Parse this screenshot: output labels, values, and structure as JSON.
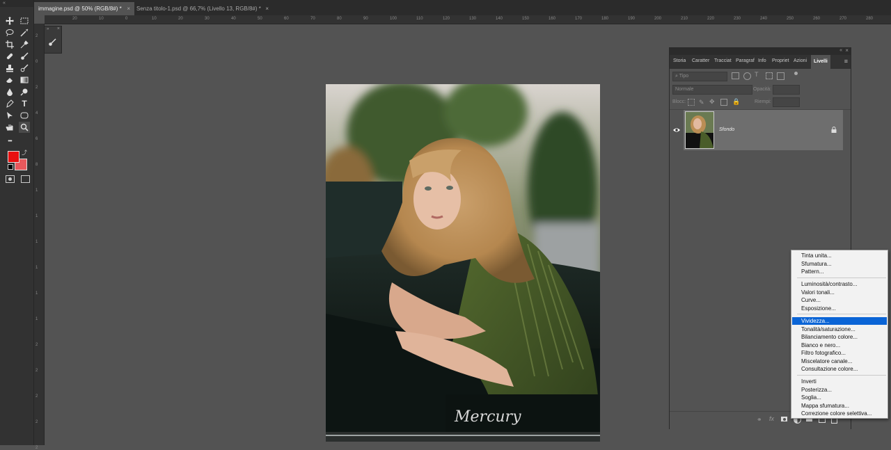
{
  "document_tabs": [
    {
      "label": "immagine.psd @ 50% (RGB/8#) *",
      "close": "×",
      "active": true
    },
    {
      "label": "Senza titolo-1.psd @ 66,7% (Livello 13, RGB/8#) *",
      "close": "×",
      "active": false
    }
  ],
  "ruler_h": [
    "20",
    "10",
    "0",
    "10",
    "20",
    "30",
    "40",
    "50",
    "60",
    "70",
    "80",
    "90",
    "100",
    "110",
    "120",
    "130",
    "140",
    "150",
    "160",
    "170",
    "180",
    "190",
    "200",
    "210",
    "220",
    "230",
    "240",
    "250",
    "260",
    "270",
    "280"
  ],
  "ruler_v": [
    "2",
    "0",
    "2",
    "4",
    "6",
    "8",
    "1",
    "1",
    "1",
    "1",
    "1",
    "1",
    "2",
    "2",
    "2",
    "2",
    "2"
  ],
  "tools": [
    "move-icon",
    "marquee-icon",
    "lasso-icon",
    "magic-wand-icon",
    "crop-icon",
    "eyedropper-icon",
    "healing-brush-icon",
    "brush-icon",
    "clone-stamp-icon",
    "history-brush-icon",
    "eraser-icon",
    "gradient-icon",
    "blur-icon",
    "dodge-icon",
    "pen-icon",
    "type-icon",
    "path-select-icon",
    "shape-icon",
    "hand-icon",
    "zoom-icon",
    "more-tools-icon"
  ],
  "tool_type_glyph": "T",
  "tool_more_glyph": "•••",
  "colors": {
    "foreground": "#e81010",
    "background": "#e8585c",
    "menu_highlight": "#0a64d6"
  },
  "canvas": {
    "plate_text": "Mercury"
  },
  "layers_panel": {
    "tabs": [
      "Storia",
      "Caratter",
      "Tracciat",
      "Paragraf",
      "Info",
      "Propriet",
      "Azioni",
      "Livelli"
    ],
    "active_tab": "Livelli",
    "filter_placeholder": "Tipo",
    "blend_mode": "Normale",
    "opacity_label": "Opacità:",
    "lock_label": "Blocc:",
    "fill_label": "Riempi:",
    "layer_name": "Sfondo",
    "menu_icon": "≡"
  },
  "adjustment_menu": {
    "group1": [
      "Tinta unita...",
      "Sfumatura...",
      "Pattern..."
    ],
    "group2": [
      "Luminosità/contrasto...",
      "Valori tonali...",
      "Curve...",
      "Esposizione..."
    ],
    "group3": [
      "Vividezza...",
      "Tonalità/saturazione...",
      "Bilanciamento colore...",
      "Bianco e nero...",
      "Filtro fotografico...",
      "Miscelatore canale...",
      "Consultazione colore..."
    ],
    "group4": [
      "Inverti",
      "Posterizza...",
      "Soglia...",
      "Mappa sfumatura...",
      "Correzione colore selettiva..."
    ],
    "selected": "Vividezza..."
  }
}
